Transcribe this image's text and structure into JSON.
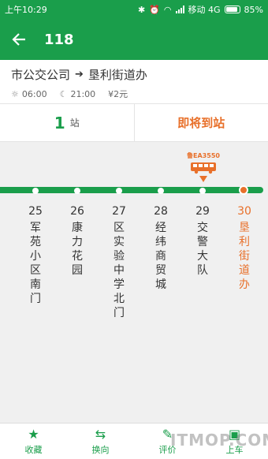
{
  "status": {
    "time": "上午10:29",
    "carrier": "移动 4G",
    "battery": "85%"
  },
  "appbar": {
    "title": "118"
  },
  "route": {
    "from": "市公交公司",
    "to": "垦利街道办",
    "start_time": "06:00",
    "end_time": "21:00",
    "fare": "¥2元"
  },
  "stats": {
    "stops_away": "1",
    "unit": "站",
    "status": "即将到站"
  },
  "bus": {
    "plate": "鲁EA3550"
  },
  "stops": [
    {
      "n": "25",
      "name": "军苑小区南门"
    },
    {
      "n": "26",
      "name": "康力花园"
    },
    {
      "n": "27",
      "name": "区实验中学北门"
    },
    {
      "n": "28",
      "name": "经纬商贸城"
    },
    {
      "n": "29",
      "name": "交警大队"
    },
    {
      "n": "30",
      "name": "垦利街道办"
    }
  ],
  "tabs": [
    {
      "label": "收藏",
      "icon": "star-icon"
    },
    {
      "label": "换向",
      "icon": "swap-icon"
    },
    {
      "label": "评价",
      "icon": "edit-icon"
    },
    {
      "label": "上车",
      "icon": "bus-icon"
    }
  ],
  "watermark": "ITMOP.COM",
  "colors": {
    "primary": "#1a9e4b",
    "accent": "#e8702a"
  }
}
